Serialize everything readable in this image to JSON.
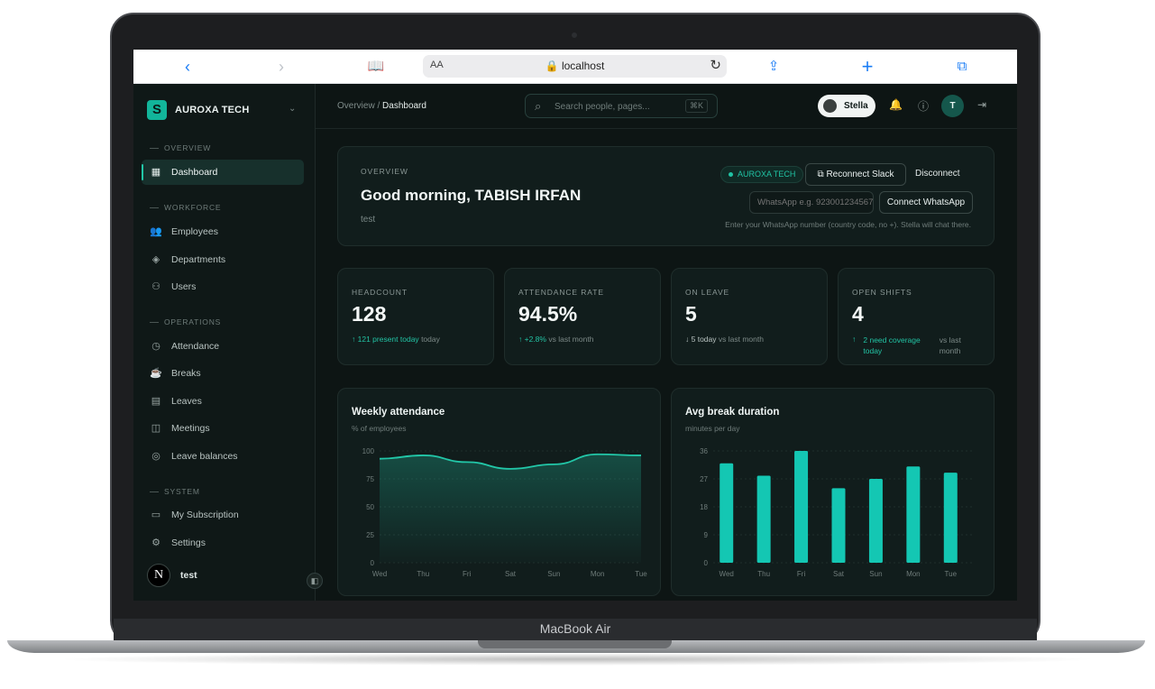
{
  "device": {
    "label": "MacBook Air"
  },
  "browser": {
    "url": "localhost",
    "aa": "AA"
  },
  "sidebar": {
    "brand": "AUROXA TECH",
    "brand_logo": "S",
    "sections": [
      {
        "label": "OVERVIEW"
      },
      {
        "label": "WORKFORCE"
      },
      {
        "label": "OPERATIONS"
      },
      {
        "label": "SYSTEM"
      }
    ],
    "items": [
      {
        "label": "Dashboard",
        "icon": "grid-icon",
        "glyph": "▦"
      },
      {
        "label": "Employees",
        "icon": "users-icon",
        "glyph": "👥"
      },
      {
        "label": "Departments",
        "icon": "layers-icon",
        "glyph": "◈"
      },
      {
        "label": "Users",
        "icon": "user-cog-icon",
        "glyph": "⚇"
      },
      {
        "label": "Attendance",
        "icon": "clock-icon",
        "glyph": "◷"
      },
      {
        "label": "Breaks",
        "icon": "coffee-icon",
        "glyph": "☕"
      },
      {
        "label": "Leaves",
        "icon": "calendar-icon",
        "glyph": "▤"
      },
      {
        "label": "Meetings",
        "icon": "calendar-clock-icon",
        "glyph": "◫"
      },
      {
        "label": "Leave balances",
        "icon": "target-icon",
        "glyph": "◎"
      },
      {
        "label": "My Subscription",
        "icon": "credit-card-icon",
        "glyph": "▭"
      },
      {
        "label": "Settings",
        "icon": "gear-icon",
        "glyph": "⚙"
      }
    ],
    "user": {
      "name": "test",
      "avatar": "N"
    }
  },
  "topbar": {
    "breadcrumb_parent": "Overview",
    "breadcrumb_current": "Dashboard",
    "search_placeholder": "Search people, pages...",
    "search_shortcut": "⌘K",
    "assistant_name": "Stella",
    "avatar_initial": "T"
  },
  "hero": {
    "eyebrow": "OVERVIEW",
    "greeting": "Good morning, TABISH IRFAN",
    "subtitle": "test",
    "org_badge": "AUROXA TECH",
    "reconnect_label": "Reconnect Slack",
    "disconnect_label": "Disconnect",
    "whatsapp_placeholder": "WhatsApp e.g. 923001234567",
    "connect_label": "Connect WhatsApp",
    "hint": "Enter your WhatsApp number (country code, no +). Stella will chat there."
  },
  "stats": [
    {
      "label": "HEADCOUNT",
      "value": "128",
      "delta": "121 present today",
      "suffix": "today",
      "trend": "up"
    },
    {
      "label": "ATTENDANCE RATE",
      "value": "94.5%",
      "delta": "+2.8%",
      "suffix": "vs last month",
      "trend": "up"
    },
    {
      "label": "ON LEAVE",
      "value": "5",
      "delta": "5 today",
      "suffix": "vs last month",
      "trend": "down"
    },
    {
      "label": "OPEN SHIFTS",
      "value": "4",
      "delta": "2 need coverage today",
      "suffix": "vs last month",
      "trend": "up"
    }
  ],
  "chart_data": [
    {
      "type": "area",
      "title": "Weekly attendance",
      "subtitle": "% of employees",
      "categories": [
        "Wed",
        "Thu",
        "Fri",
        "Sat",
        "Sun",
        "Mon",
        "Tue"
      ],
      "values": [
        93,
        96,
        90,
        84,
        88,
        97,
        96
      ],
      "ylim": [
        0,
        100
      ],
      "yticks": [
        0,
        25,
        50,
        75,
        100
      ],
      "color": "#22c7a8",
      "grid": true
    },
    {
      "type": "bar",
      "title": "Avg break duration",
      "subtitle": "minutes per day",
      "categories": [
        "Wed",
        "Thu",
        "Fri",
        "Sat",
        "Sun",
        "Mon",
        "Tue"
      ],
      "values": [
        32,
        28,
        36,
        24,
        27,
        31,
        29
      ],
      "ylim": [
        0,
        36
      ],
      "yticks": [
        0,
        9,
        18,
        27,
        36
      ],
      "color": "#14c7b3",
      "grid": true
    }
  ]
}
